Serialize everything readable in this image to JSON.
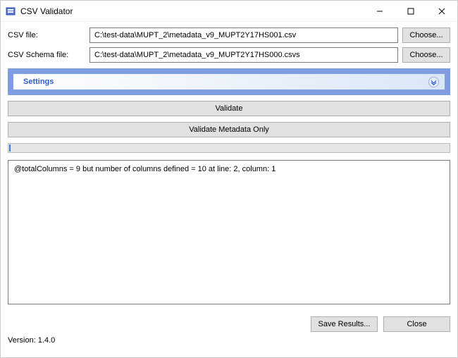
{
  "window": {
    "title": "CSV Validator"
  },
  "form": {
    "csv_label": "CSV file:",
    "csv_value": "C:\\test-data\\MUPT_2\\metadata_v9_MUPT2Y17HS001.csv",
    "schema_label": "CSV Schema file:",
    "schema_value": "C:\\test-data\\MUPT_2\\metadata_v9_MUPT2Y17HS000.csvs",
    "choose_label": "Choose..."
  },
  "settings": {
    "label": "Settings"
  },
  "buttons": {
    "validate": "Validate",
    "validate_meta": "Validate Metadata Only",
    "save_results": "Save Results...",
    "close": "Close"
  },
  "output": "@totalColumns = 9 but number of columns defined = 10 at line: 2, column: 1",
  "version_label": "Version: 1.4.0"
}
